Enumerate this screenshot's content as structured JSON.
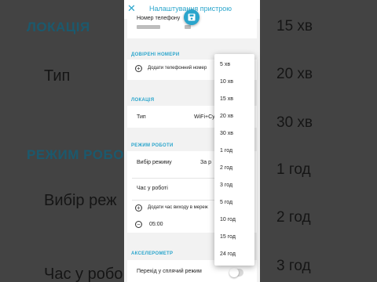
{
  "background": {
    "section_location": "ЛОКАЦІЯ",
    "section_mode": "РЕЖИМ РОБОТ",
    "label_type": "Тип",
    "label_mode_select": "Вибір реж",
    "label_work_time": "Час у робо",
    "values": [
      "15 хв",
      "20 хв",
      "30 хв",
      "1 год",
      "2 год",
      "3 год"
    ]
  },
  "header": {
    "title": "Налаштування пристрою",
    "close_glyph": "✕"
  },
  "phone_section": {
    "label": "Номер телефону"
  },
  "trusted_numbers": {
    "heading": "ДОВІРЕНІ НОМЕРИ",
    "add_label": "Додати телефонний номер"
  },
  "location": {
    "heading": "ЛОКАЦІЯ",
    "type_label": "Тип",
    "type_value": "WiFi+Су"
  },
  "work_mode": {
    "heading": "РЕЖИМ РОБОТИ",
    "mode_label": "Вибір режиму",
    "mode_value": "За р",
    "work_time_label": "Час у роботі",
    "add_exit_time_label": "Додати час виходу в мереж",
    "exit_time": "05:00"
  },
  "accelerometer": {
    "heading": "АКСЕЛЕРОМЕТР",
    "sleep_mode_label": "Перехід у сплячий режим",
    "sleep_mode_on": false
  },
  "dropdown": {
    "options": [
      "5 хв",
      "10 хв",
      "15 хв",
      "20 хв",
      "30 хв",
      "1 год",
      "2 год",
      "3 год",
      "5 год",
      "10 год",
      "15 год",
      "24 год"
    ]
  },
  "colors": {
    "accent": "#2aa5cc"
  }
}
